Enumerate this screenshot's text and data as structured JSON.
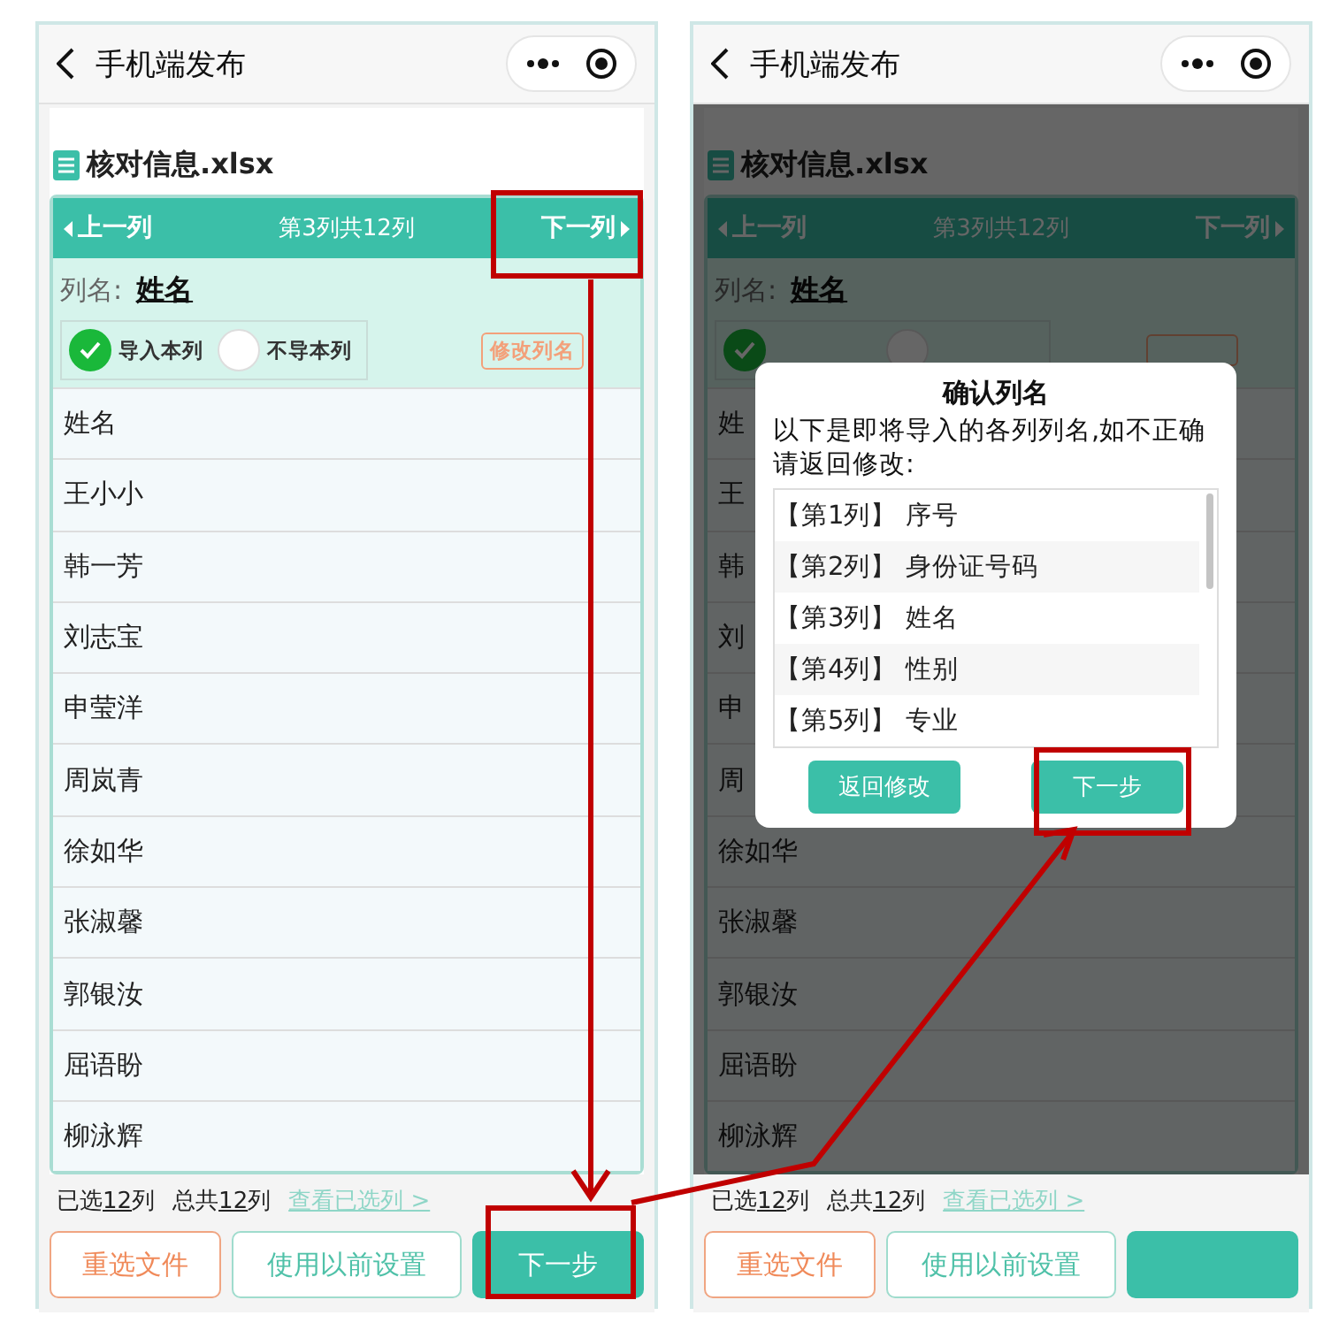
{
  "screens": [
    {
      "title": "手机端发布",
      "file_name": "核对信息.xlsx",
      "pager": {
        "prev": "上一列",
        "position": "第3列共12列",
        "next": "下一列"
      },
      "column_label": "列名:",
      "column_name": "姓名",
      "options": [
        {
          "label": "导入本列",
          "selected": true
        },
        {
          "label": "不导本列",
          "selected": false
        }
      ],
      "rename_button": "修改列名",
      "rows": [
        "姓名",
        "王小小",
        "韩一芳",
        "刘志宝",
        "申莹洋",
        "周岚青",
        "徐如华",
        "张淑馨",
        "郭银汝",
        "屈语盼",
        "柳泳辉"
      ],
      "summary": {
        "selected_prefix": "已选",
        "selected_count": "12",
        "selected_suffix": "列",
        "total_prefix": "总共",
        "total_count": "12",
        "total_suffix": "列",
        "link": "查看已选列 >"
      },
      "buttons": [
        {
          "kind": "secondary",
          "label": "重选文件"
        },
        {
          "kind": "outline",
          "label": "使用以前设置"
        },
        {
          "kind": "primary",
          "label": "下一步"
        }
      ],
      "dimmed": false
    },
    {
      "title": "手机端发布",
      "file_name": "核对信息.xlsx",
      "pager": {
        "prev": "上一列",
        "position": "第3列共12列",
        "next": "下一列"
      },
      "column_label": "列名:",
      "column_name": "姓名",
      "options": [
        {
          "selected": true
        },
        {
          "selected": false
        }
      ],
      "rows": [
        "姓",
        "王",
        "韩",
        "刘",
        "申",
        "周",
        "徐如华",
        "张淑馨",
        "郭银汝",
        "屈语盼",
        "柳泳辉"
      ],
      "summary": {
        "selected_prefix": "已选",
        "selected_count": "12",
        "selected_suffix": "列",
        "total_prefix": "总共",
        "total_count": "12",
        "total_suffix": "列",
        "link": "查看已选列 >"
      },
      "buttons": [
        {
          "kind": "secondary",
          "label": "重选文件"
        },
        {
          "kind": "outline",
          "label": "使用以前设置"
        },
        {
          "kind": "primary"
        }
      ],
      "dimmed": true,
      "dialog": {
        "title": "确认列名",
        "message": "以下是即将导入的各列列名,如不正确请返回修改:",
        "items": [
          "【第1列】 序号",
          "【第2列】 身份证号码",
          "【第3列】 姓名",
          "【第4列】 性别",
          "【第5列】 专业"
        ],
        "buttons": [
          "返回修改",
          "下一步"
        ]
      }
    }
  ]
}
